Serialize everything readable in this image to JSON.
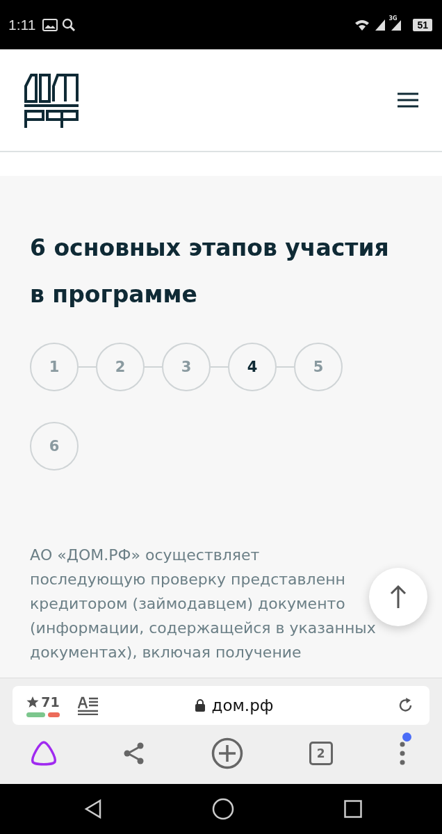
{
  "status_bar": {
    "time": "1:11",
    "network": "3G",
    "battery": "51"
  },
  "page": {
    "title": "6 основных этапов участия в программе",
    "steps": [
      {
        "label": "1",
        "selected": false
      },
      {
        "label": "2",
        "selected": false
      },
      {
        "label": "3",
        "selected": false
      },
      {
        "label": "4",
        "selected": true
      },
      {
        "label": "5",
        "selected": false
      },
      {
        "label": "6",
        "selected": false
      }
    ],
    "paragraph_lines": [
      "АО «ДОМ.РФ» осуществляет",
      "последующую проверку представленн",
      "кредитором (займодавцем) документо",
      "(информации, содержащейся в указанных",
      "документах), включая получение"
    ]
  },
  "browser": {
    "rating": "71",
    "address": "дом.рф",
    "tab_count": "2",
    "menu_notification": true
  }
}
